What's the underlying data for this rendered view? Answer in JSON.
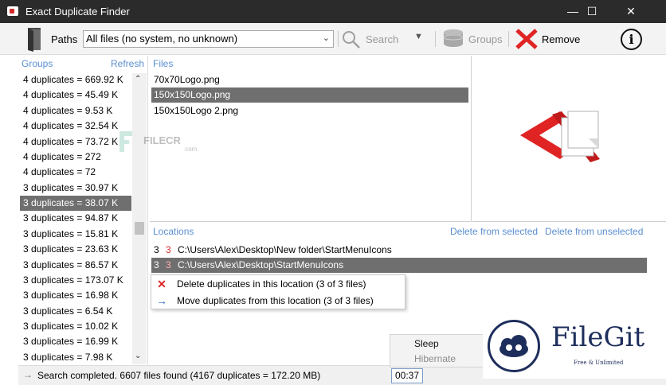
{
  "window": {
    "title": "Exact Duplicate Finder",
    "minimize": "—",
    "maximize": "☐",
    "close": "✕"
  },
  "toolbar": {
    "paths_label": "Paths",
    "filter_value": "All files (no system, no unknown)",
    "search_label": "Search",
    "groups_label": "Groups",
    "remove_label": "Remove",
    "info_label": "i"
  },
  "groups_panel": {
    "header": "Groups",
    "refresh_label": "Refresh",
    "items": [
      "4 duplicates = 669.92 K",
      "4 duplicates = 45.49 K",
      "4 duplicates = 9.53 K",
      "4 duplicates = 32.54 K",
      "4 duplicates = 73.72 K",
      "4 duplicates = 272",
      "4 duplicates = 72",
      "3 duplicates = 30.97 K",
      "3 duplicates = 38.07 K",
      "3 duplicates = 94.87 K",
      "3 duplicates = 15.81 K",
      "3 duplicates = 23.63 K",
      "3 duplicates = 86.57 K",
      "3 duplicates = 173.07 K",
      "3 duplicates = 16.98 K",
      "3 duplicates = 6.54 K",
      "3 duplicates = 10.02 K",
      "3 duplicates = 16.99 K",
      "3 duplicates = 7.98 K"
    ],
    "selected_index": 8
  },
  "files_panel": {
    "header": "Files",
    "items": [
      "70x70Logo.png",
      "150x150Logo.png",
      "150x150Logo 2.png"
    ],
    "selected_index": 1
  },
  "locations_panel": {
    "header": "Locations",
    "delete_from_selected": "Delete from selected",
    "delete_from_unselected": "Delete from unselected",
    "rows": [
      {
        "count_a": "3",
        "count_b": "3",
        "path": "C:\\Users\\Alex\\Desktop\\New folder\\StartMenuIcons"
      },
      {
        "count_a": "3",
        "count_b": "3",
        "path": "C:\\Users\\Alex\\Desktop\\StartMenuIcons"
      }
    ],
    "selected_index": 1
  },
  "context_menu": {
    "items": [
      {
        "label": "Delete duplicates in this location (3 of 3 files)",
        "icon": "red-x-icon"
      },
      {
        "label": "Move duplicates from this location (3 of 3 files)",
        "icon": "arrow-right-icon"
      }
    ]
  },
  "power_menu": {
    "items": [
      "Sleep",
      "Hibernate"
    ]
  },
  "status": {
    "text": "Search completed. 6607 files found (4167 duplicates = 172.20 MB)",
    "time": "00:37"
  },
  "watermarks": {
    "filecr": "FILECR",
    "filecr_sub": ".com",
    "filegit": "FileGit",
    "filegit_sub": "Free & Unlimited"
  },
  "colors": {
    "accent_blue": "#5b8fd0",
    "selection_gray": "#6f6f6f",
    "remove_red": "#e02424",
    "titlebar": "#2b2b2b"
  }
}
